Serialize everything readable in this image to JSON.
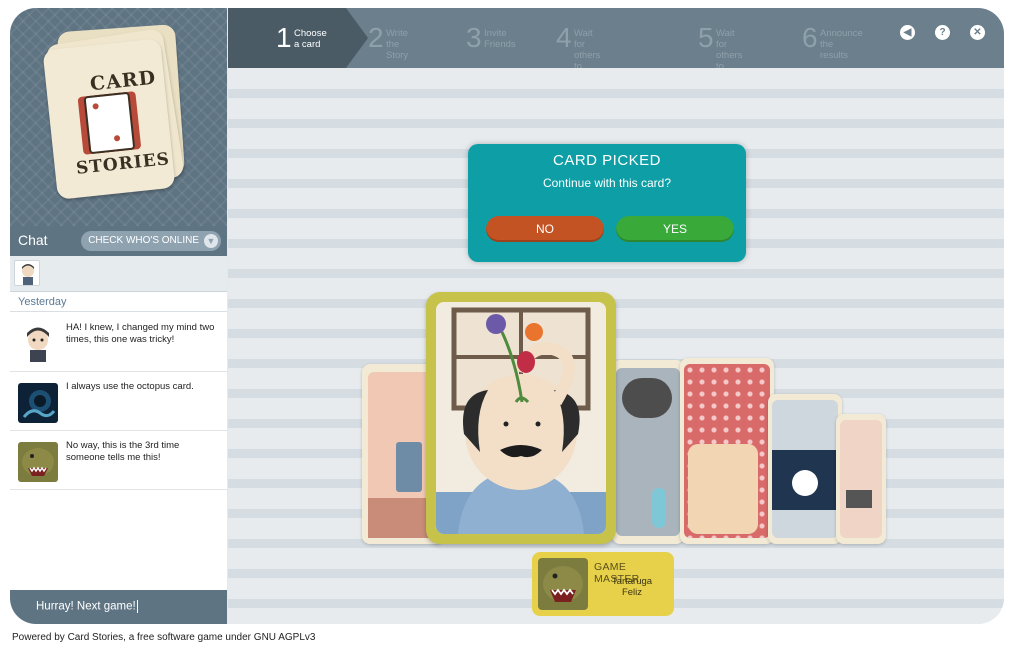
{
  "app": {
    "name": "Card Stories"
  },
  "logo": {
    "line1": "CARD",
    "line2": "STORIES"
  },
  "steps": [
    {
      "number": "1",
      "label": "Choose\na card",
      "active": true
    },
    {
      "number": "2",
      "label": "Write\nthe Story",
      "active": false
    },
    {
      "number": "3",
      "label": "Invite\nFriends",
      "active": false
    },
    {
      "number": "4",
      "label": "Wait for others\nto choose a card",
      "active": false
    },
    {
      "number": "5",
      "label": "Wait for\nothers to vote",
      "active": false
    },
    {
      "number": "6",
      "label": "Announce\nthe results",
      "active": false
    }
  ],
  "top_icons": [
    {
      "name": "back-icon",
      "glyph": "◀"
    },
    {
      "name": "help-icon",
      "glyph": "?"
    },
    {
      "name": "close-icon",
      "glyph": "✕"
    }
  ],
  "chat": {
    "title": "Chat",
    "online_button": "CHECK WHO'S ONLINE",
    "day_label": "Yesterday",
    "messages": [
      {
        "avatar": "boy-avatar",
        "text": "HA! I knew, I changed my mind two times, this one was tricky!"
      },
      {
        "avatar": "octopus-avatar",
        "text": "I always use the octopus card."
      },
      {
        "avatar": "monster-avatar",
        "text": "No way, this is the 3rd time someone tells me this!"
      }
    ],
    "input_value": "Hurray! Next game!"
  },
  "dialog": {
    "title": "CARD PICKED",
    "question": "Continue with this card?",
    "no_label": "NO",
    "yes_label": "YES"
  },
  "game_master": {
    "title": "GAME MASTER",
    "name": "Tartaruga\nFeliz"
  },
  "footer": "Powered by Card Stories, a free software game under GNU AGPLv3",
  "colors": {
    "panel": "#5f7483",
    "step_bar": "#6b7f8c",
    "dialog": "#0e9ea6",
    "no_button": "#c35322",
    "yes_button": "#39a93a",
    "selected_card_frame": "#c6c24a",
    "game_master_box": "#e7d14b"
  }
}
